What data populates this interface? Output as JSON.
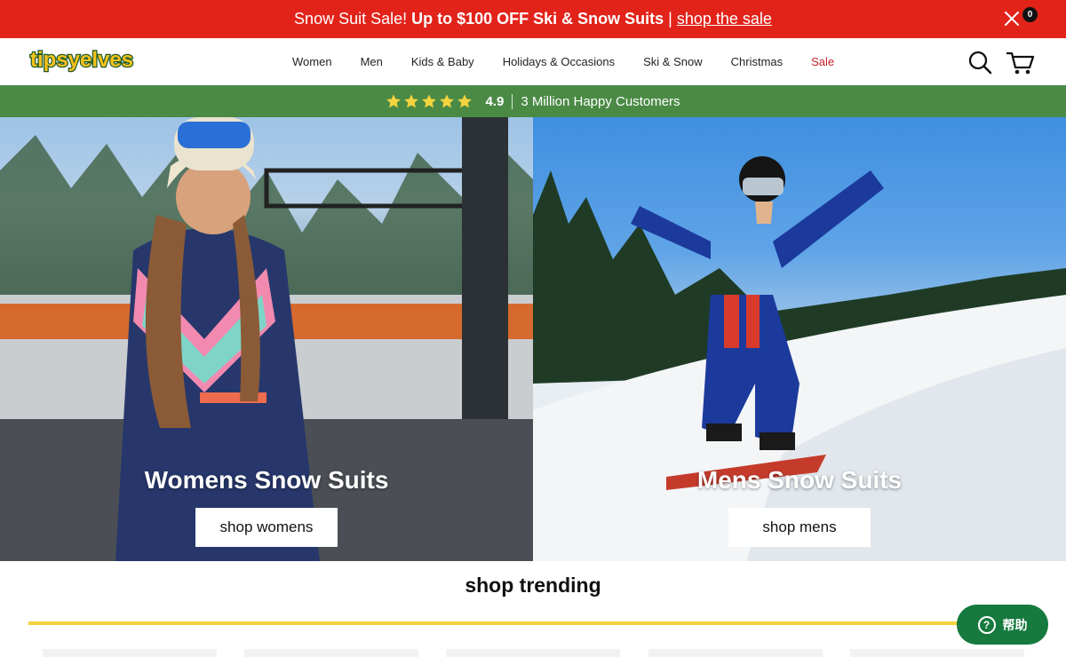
{
  "promo": {
    "lead": "Snow Suit Sale!",
    "strong": "Up to $100 OFF Ski & Snow Suits",
    "separator": "|",
    "link": "shop the sale",
    "close_icon": "close-icon"
  },
  "header": {
    "logo_text": "tipsyelves",
    "nav": [
      "Women",
      "Men",
      "Kids & Baby",
      "Holidays & Occasions",
      "Ski & Snow",
      "Christmas",
      "Sale"
    ],
    "search_icon": "search-icon",
    "cart_icon": "cart-icon",
    "cart_count": "0"
  },
  "rating": {
    "stars": 5,
    "score": "4.9",
    "customers": "3 Million Happy Customers"
  },
  "hero": {
    "womens": {
      "title": "Womens Snow Suits",
      "button": "shop womens"
    },
    "mens": {
      "title": "Mens Snow Suits",
      "button": "shop mens"
    }
  },
  "trending": {
    "title": "shop trending"
  },
  "help": {
    "label": "帮助",
    "icon": "question-icon"
  },
  "colors": {
    "promo_bg": "#e2231a",
    "rating_bg": "#4a8a45",
    "accent_yellow": "#f2d33b",
    "help_bg": "#167a3f",
    "sale_red": "#c8202a"
  }
}
